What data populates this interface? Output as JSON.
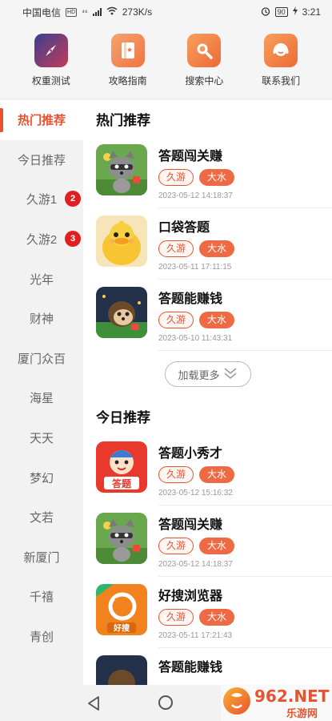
{
  "status_bar": {
    "carrier": "中国电信",
    "hd": "HD",
    "network": "⁴⁶",
    "speed": "273K/s",
    "battery": "90",
    "time": "3:21"
  },
  "top_nav": [
    {
      "label": "权重测试",
      "icon": "compass-icon",
      "color": "#2e3a78"
    },
    {
      "label": "攻略指南",
      "icon": "guide-book-icon",
      "color": "#f08a55"
    },
    {
      "label": "搜索中心",
      "icon": "search-icon",
      "color": "#f07a40"
    },
    {
      "label": "联系我们",
      "icon": "customer-service-icon",
      "color": "#f07a40"
    }
  ],
  "sidebar": {
    "items": [
      {
        "label": "热门推荐",
        "active": true
      },
      {
        "label": "今日推荐"
      },
      {
        "label": "久游1",
        "badge": "2"
      },
      {
        "label": "久游2",
        "badge": "3"
      },
      {
        "label": "光年"
      },
      {
        "label": "财神"
      },
      {
        "label": "厦门众百"
      },
      {
        "label": "海星"
      },
      {
        "label": "天天"
      },
      {
        "label": "梦幻"
      },
      {
        "label": "文若"
      },
      {
        "label": "新厦门"
      },
      {
        "label": "千禧"
      },
      {
        "label": "青创"
      }
    ]
  },
  "hot_section": {
    "title": "热门推荐",
    "apps": [
      {
        "name": "答题闯关赚",
        "tag1": "久游",
        "tag2": "大水",
        "time": "2023-05-12 14:18:37",
        "thumb": "raccoon"
      },
      {
        "name": "口袋答题",
        "tag1": "久游",
        "tag2": "大水",
        "time": "2023-05-11 17:11:15",
        "thumb": "duck"
      },
      {
        "name": "答题能赚钱",
        "tag1": "久游",
        "tag2": "大水",
        "time": "2023-05-10 11:43:31",
        "thumb": "hedgehog"
      }
    ],
    "load_more": "加载更多"
  },
  "today_section": {
    "title": "今日推荐",
    "apps": [
      {
        "name": "答题小秀才",
        "tag1": "久游",
        "tag2": "大水",
        "time": "2023-05-12 15:16:32",
        "thumb": "scholar",
        "thumb_text": "答题"
      },
      {
        "name": "答题闯关赚",
        "tag1": "久游",
        "tag2": "大水",
        "time": "2023-05-12 14:18:37",
        "thumb": "raccoon"
      },
      {
        "name": "好搜浏览器",
        "tag1": "久游",
        "tag2": "大水",
        "time": "2023-05-11 17:21:43",
        "thumb": "browser",
        "thumb_text": "好搜"
      },
      {
        "name": "答题能赚钱",
        "thumb": "hedgehog"
      }
    ]
  },
  "watermark": {
    "brand": "962.NET",
    "sub": "乐游网"
  },
  "colors": {
    "accent": "#e8532f",
    "tag_solid": "#ee6a45",
    "download": "#4a90e2",
    "badge": "#e02020"
  }
}
